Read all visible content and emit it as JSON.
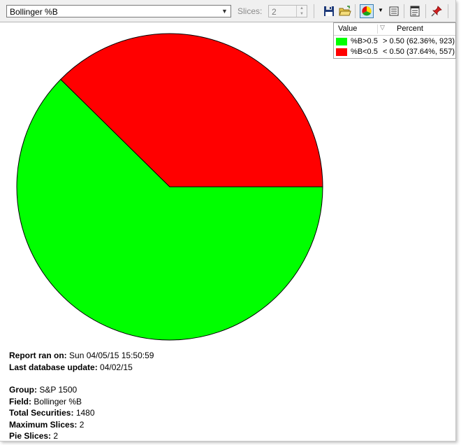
{
  "toolbar": {
    "indicator": "Bollinger %B",
    "slices_label": "Slices:",
    "slices_value": "2",
    "icons": [
      "save-icon",
      "open-folder-icon",
      "pie-chart-icon",
      "list-icon",
      "report-icon",
      "pin-icon"
    ]
  },
  "legend": {
    "col_value": "Value",
    "col_percent": "Percent",
    "rows": [
      {
        "label": "%B>0.5",
        "percent": "> 0.50 (62.36%, 923)",
        "color": "#00ff00"
      },
      {
        "label": "%B<0.5",
        "percent": "< 0.50 (37.64%, 557)",
        "color": "#ff0000"
      }
    ]
  },
  "chart_data": {
    "type": "pie",
    "slices": [
      {
        "label": "%B>0.5",
        "value": 923,
        "percent": 62.36,
        "color": "#00ff00"
      },
      {
        "label": "%B<0.5",
        "value": 557,
        "percent": 37.64,
        "color": "#ff0000"
      }
    ],
    "start_angle_deg": 0,
    "direction": "clockwise"
  },
  "report": {
    "ran_label": "Report ran on:",
    "ran_value": "Sun 04/05/15 15:50:59",
    "db_label": "Last database update:",
    "db_value": "04/02/15",
    "group_label": "Group:",
    "group_value": "S&P 1500",
    "field_label": "Field:",
    "field_value": "Bollinger %B",
    "total_label": "Total Securities:",
    "total_value": "1480",
    "max_label": "Maximum Slices:",
    "max_value": "2",
    "pie_label": "Pie Slices:",
    "pie_value": "2"
  }
}
